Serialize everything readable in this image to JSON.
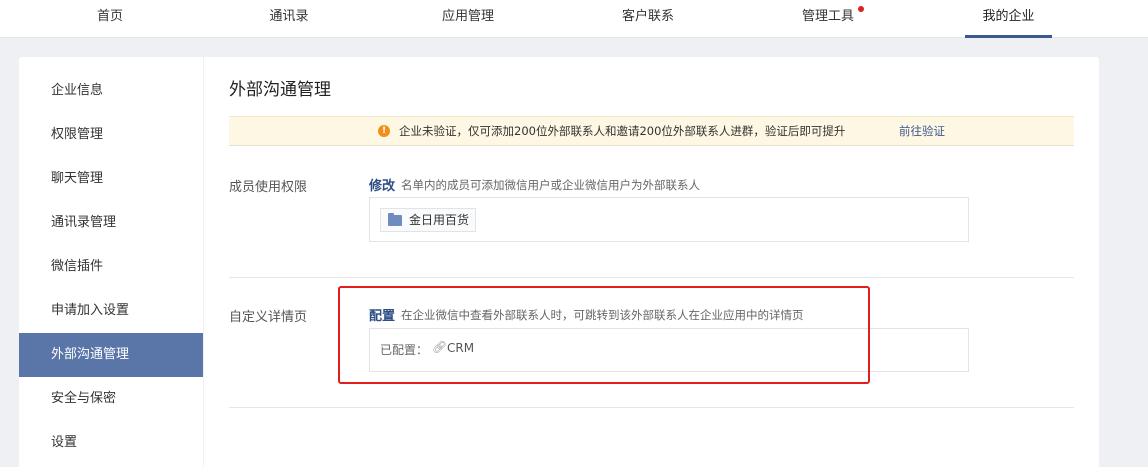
{
  "topnav": {
    "tabs": [
      {
        "label": "首页"
      },
      {
        "label": "通讯录"
      },
      {
        "label": "应用管理"
      },
      {
        "label": "客户联系"
      },
      {
        "label": "管理工具"
      },
      {
        "label": "我的企业"
      }
    ],
    "active_tab": "我的企业",
    "notification_tab": "管理工具",
    "accent_color": "#3a5a8f",
    "dot_color": "#e02020"
  },
  "sidebar": {
    "items": [
      {
        "label": "企业信息"
      },
      {
        "label": "权限管理"
      },
      {
        "label": "聊天管理"
      },
      {
        "label": "通讯录管理"
      },
      {
        "label": "微信插件"
      },
      {
        "label": "申请加入设置"
      },
      {
        "label": "外部沟通管理"
      },
      {
        "label": "安全与保密"
      },
      {
        "label": "设置"
      }
    ],
    "active_item": "外部沟通管理",
    "active_color": "#5a76a8"
  },
  "main": {
    "title": "外部沟通管理",
    "notice": {
      "icon": "warning-icon",
      "message": "企业未验证，仅可添加200位外部联系人和邀请200位外部联系人进群，验证后即可提升",
      "link": "前往验证"
    },
    "member_permission": {
      "label": "成员使用权限",
      "action": "修改",
      "description": "名单内的成员可添加微信用户或企业微信用户为外部联系人",
      "tag": {
        "icon": "folder-icon",
        "label": "金日用百货"
      }
    },
    "custom_detail": {
      "label": "自定义详情页",
      "action": "配置",
      "description": "在企业微信中查看外部联系人时，可跳转到该外部联系人在企业应用中的详情页",
      "configured_label": "已配置：",
      "configured_icon": "link-icon",
      "configured_value": "CRM"
    }
  },
  "highlight_color": "#e01e1e"
}
